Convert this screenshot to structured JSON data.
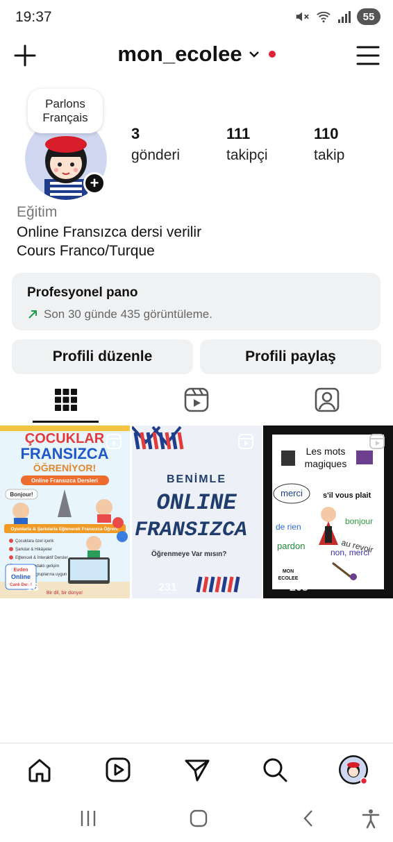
{
  "status_bar": {
    "time": "19:37",
    "battery": "55"
  },
  "header": {
    "username": "mon_ecolee"
  },
  "profile": {
    "note": {
      "line1": "Parlons",
      "line2": "Français"
    },
    "stats": [
      {
        "value": "3",
        "label": "gönderi"
      },
      {
        "value": "111",
        "label": "takipçi"
      },
      {
        "value": "110",
        "label": "takip"
      }
    ],
    "category": "Eğitim",
    "bio_lines": [
      "Online Fransızca dersi verilir",
      "Cours Franco/Turque"
    ]
  },
  "professional_dashboard": {
    "title": "Profesyonel pano",
    "subtitle": "Son 30 günde 435 görüntüleme."
  },
  "buttons": {
    "edit_profile": "Profili düzenle",
    "share_profile": "Profili paylaş"
  },
  "posts": [
    {
      "title_line1": "ÇOCUKLAR",
      "title_line2": "FRANSIZCA",
      "title_line3": "ÖĞRENİYOR!",
      "subtitle": "Online Fransızca Dersleri",
      "greeting": "Bonjour!",
      "banner": "Oyunlarla & Şarkılarla Eğlenerek Fransızca Öğren!",
      "features": [
        "Çocuklara özel içerik",
        "Şarkılar & Hikâyeler",
        "Eğlenceli & İnteraktif Dersler",
        "Konuşma odaklı gelişim",
        "Küçük yaş gruplarına uygun"
      ],
      "badge_line1": "Evden",
      "badge_line2": "Online",
      "badge_line3": "Canlı Ders!",
      "footer": "Bir dil, bir dünya!",
      "views": "16"
    },
    {
      "line1": "BENİMLE",
      "line2": "ONLINE",
      "line3": "FRANSIZCA",
      "question": "Öğrenmeye Var mısın?",
      "views": "231"
    },
    {
      "title_line1": "Les mots",
      "title_line2": "magiques",
      "words": [
        "merci",
        "s'il vous plait",
        "bonjour",
        "de rien",
        "au revoir",
        "pardon",
        "non, merci"
      ],
      "logo_line1": "MON",
      "logo_line2": "ECOLEE",
      "views": "208"
    }
  ]
}
